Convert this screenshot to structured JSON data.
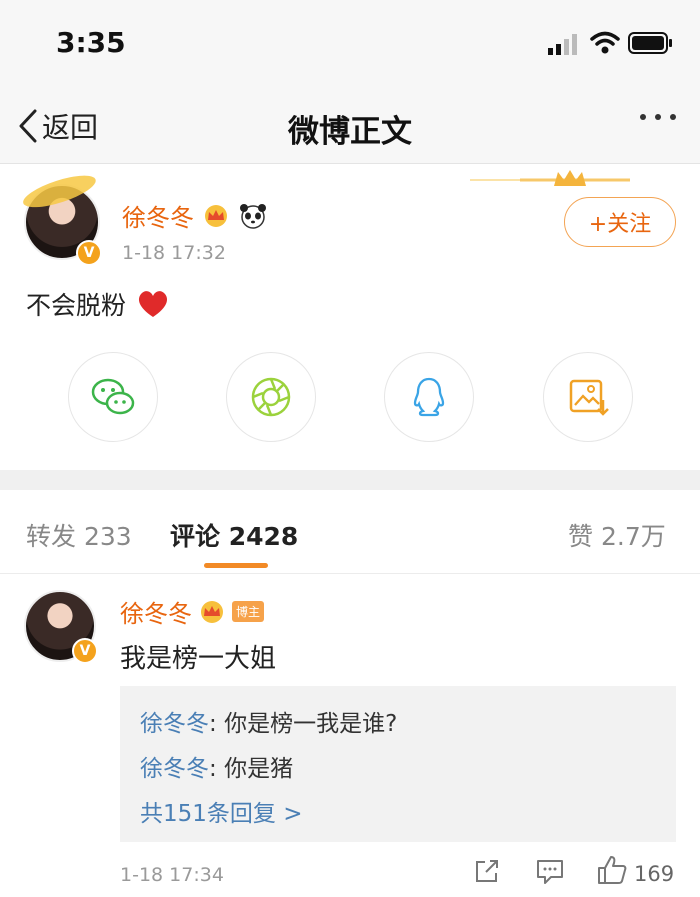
{
  "status_bar": {
    "time": "3:35"
  },
  "nav": {
    "back_label": "返回",
    "title": "微博正文"
  },
  "post": {
    "author": "徐冬冬",
    "time": "1-18 17:32",
    "follow_label": "+关注",
    "text": "不会脱粉",
    "share_icons": [
      "wechat-icon",
      "moments-icon",
      "qq-icon",
      "save-image-icon"
    ]
  },
  "tabs": {
    "repost_label": "转发",
    "repost_count": "233",
    "comment_label": "评论",
    "comment_count": "2428",
    "like_label": "赞",
    "like_count": "2.7万"
  },
  "comment": {
    "author": "徐冬冬",
    "badge": "博主",
    "text": "我是榜一大姐",
    "replies": [
      {
        "name": "徐冬冬",
        "sep": ": ",
        "text": "你是榜一我是谁?"
      },
      {
        "name": "徐冬冬",
        "sep": ": ",
        "text": "你是猪"
      }
    ],
    "more_replies": "共151条回复 >",
    "time": "1-18 17:34",
    "likes": "169"
  },
  "colors": {
    "accent": "#e8650f",
    "link": "#4a7fb5",
    "tab_underline": "#f28a26"
  }
}
